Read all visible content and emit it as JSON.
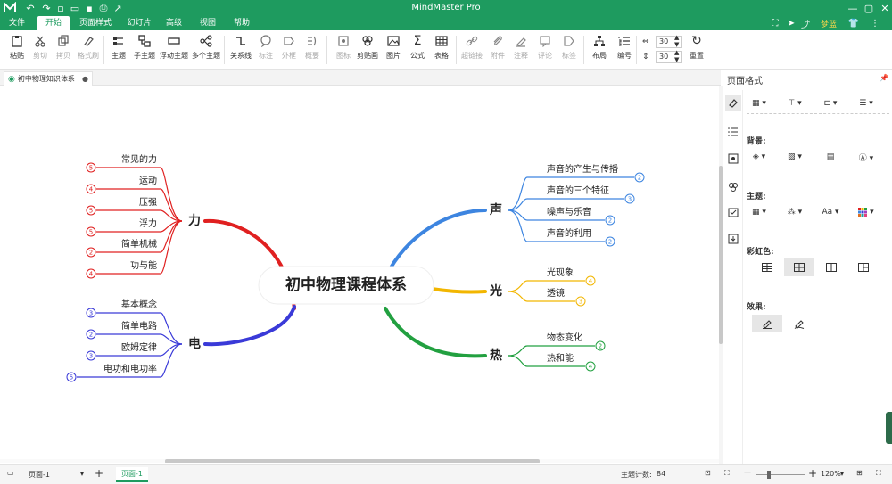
{
  "titlebar": {
    "app_title": "MindMaster Pro",
    "logo_icon": "mindmaster-logo-icon",
    "quick_access": [
      "undo-icon",
      "redo-icon",
      "new-icon",
      "open-icon",
      "save-icon",
      "print-icon",
      "export-icon"
    ]
  },
  "menu": {
    "tabs": [
      "文件",
      "开始",
      "页面样式",
      "幻灯片",
      "高级",
      "视图",
      "帮助"
    ],
    "active": "开始",
    "user_label": "梦蓝"
  },
  "ribbon": {
    "paste": "粘贴",
    "cut": "剪切",
    "copy": "拷贝",
    "format_painter": "格式刷",
    "topic": "主题",
    "subtopic": "子主题",
    "floating_topic": "浮动主题",
    "multiple_topics": "多个主题",
    "relationship": "关系线",
    "callout": "标注",
    "boundary": "外框",
    "summary": "概要",
    "icon": "图标",
    "clipart": "剪贴画",
    "image": "图片",
    "formula": "公式",
    "table": "表格",
    "hyperlink": "超链接",
    "attachment": "附件",
    "note": "注释",
    "comment": "评论",
    "tag": "标签",
    "layout": "布局",
    "numbering": "编号",
    "spacing_h": "30",
    "spacing_v": "30",
    "reset": "重置"
  },
  "document": {
    "tab_name": "初中物理知识体系"
  },
  "mindmap": {
    "central": "初中物理课程体系",
    "branches": [
      {
        "label": "力",
        "color": "#e02020",
        "children": [
          {
            "label": "常见的力",
            "count": "5"
          },
          {
            "label": "运动",
            "count": "4"
          },
          {
            "label": "压强",
            "count": "5"
          },
          {
            "label": "浮力",
            "count": "5"
          },
          {
            "label": "简单机械",
            "count": "2"
          },
          {
            "label": "功与能",
            "count": "4"
          }
        ]
      },
      {
        "label": "电",
        "color": "#3a3ad8",
        "children": [
          {
            "label": "基本概念",
            "count": "3"
          },
          {
            "label": "简单电路",
            "count": "2"
          },
          {
            "label": "欧姆定律",
            "count": "3"
          },
          {
            "label": "电功和电功率",
            "count": "5"
          }
        ]
      },
      {
        "label": "声",
        "color": "#3d85e0",
        "children": [
          {
            "label": "声音的产生与传播",
            "count": "2"
          },
          {
            "label": "声音的三个特征",
            "count": "3"
          },
          {
            "label": "噪声与乐音",
            "count": "2"
          },
          {
            "label": "声音的利用",
            "count": "2"
          }
        ]
      },
      {
        "label": "光",
        "color": "#f2b600",
        "children": [
          {
            "label": "光现象",
            "count": "4"
          },
          {
            "label": "透镜",
            "count": "3"
          }
        ]
      },
      {
        "label": "热",
        "color": "#22a040",
        "children": [
          {
            "label": "物态变化",
            "count": "2"
          },
          {
            "label": "热和能",
            "count": "4"
          }
        ]
      }
    ]
  },
  "panel": {
    "title": "页面格式",
    "background_label": "背景:",
    "theme_label": "主题:",
    "rainbow_label": "彩虹色:",
    "effect_label": "效果:",
    "font_label": "Aa"
  },
  "status": {
    "page_select": "页面-1",
    "page_tab": "页面-1",
    "topic_count_label": "主题计数:",
    "topic_count": "84",
    "zoom": "120%"
  },
  "colors": {
    "brand": "#1e9b5f"
  }
}
